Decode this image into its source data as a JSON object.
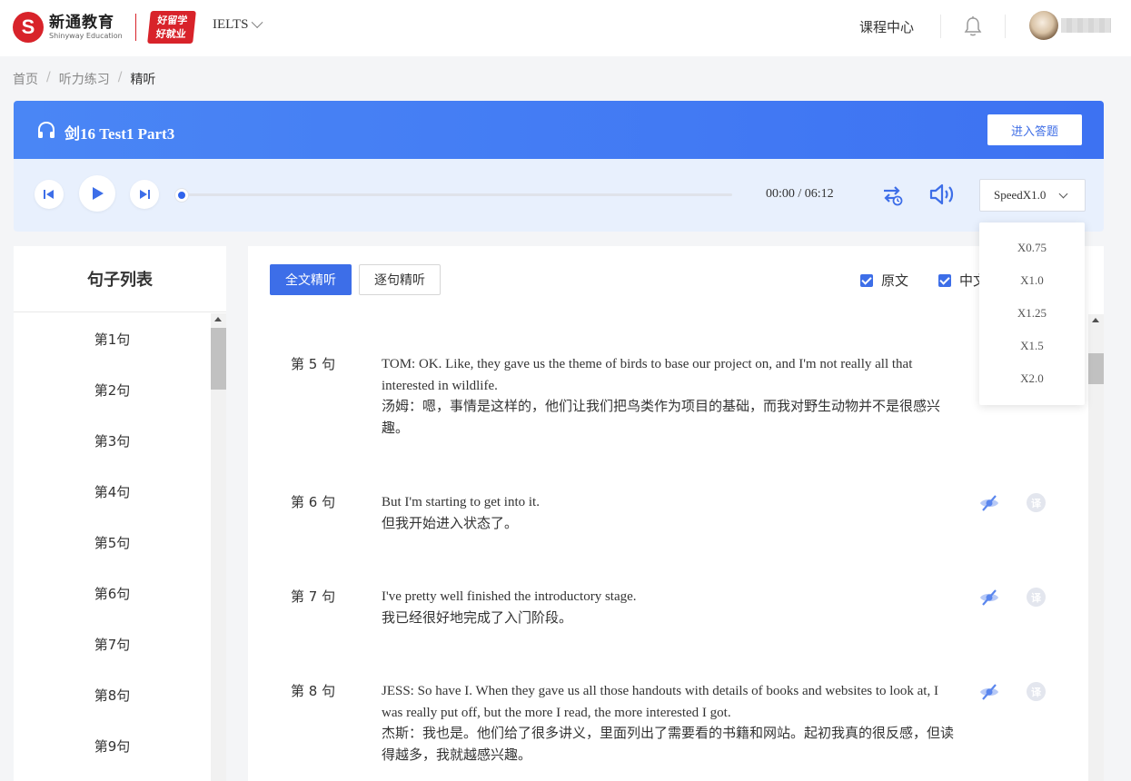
{
  "header": {
    "logo_cn": "新通教育",
    "logo_en": "Shinyway Education",
    "slogan_line1": "好留学",
    "slogan_line2": "好就业",
    "exam": "IELTS",
    "course_center": "课程中心"
  },
  "breadcrumb": {
    "home": "首页",
    "section": "听力练习",
    "current": "精听"
  },
  "player": {
    "title": "剑16 Test1 Part3",
    "answer_button": "进入答题",
    "time": "00:00 / 06:12",
    "progress": 0,
    "speed": "SpeedX1.0",
    "speed_options": [
      "X0.75",
      "X1.0",
      "X1.25",
      "X1.5",
      "X2.0"
    ]
  },
  "sidebar": {
    "title": "句子列表",
    "items": [
      "第1句",
      "第2句",
      "第3句",
      "第4句",
      "第5句",
      "第6句",
      "第7句",
      "第8句",
      "第9句"
    ]
  },
  "main": {
    "tabs": [
      "全文精听",
      "逐句精听"
    ],
    "toggles": [
      "原文",
      "中文"
    ],
    "sentences": [
      {
        "num": "第 5 句",
        "en": "TOM: OK. Like, they gave us the theme of birds to base our project on, and I'm not really all that interested in wildlife.",
        "cn": "汤姆：嗯，事情是这样的，他们让我们把鸟类作为项目的基础，而我对野生动物并不是很感兴趣。"
      },
      {
        "num": "第 6 句",
        "en": "But I'm starting to get into it.",
        "cn": "但我开始进入状态了。"
      },
      {
        "num": "第 7 句",
        "en": "I've pretty well finished the introductory stage.",
        "cn": "我已经很好地完成了入门阶段。"
      },
      {
        "num": "第 8 句",
        "en": "JESS: So have I. When they gave us all those handouts with details of books and websites to look at, I was really put off, but the more I read, the more interested I got.",
        "cn": "杰斯：我也是。他们给了很多讲义，里面列出了需要看的书籍和网站。起初我真的很反感，但读得越多，我就越感兴趣。"
      }
    ],
    "translate_icon": "译"
  },
  "colors": {
    "accent": "#3d6ee8",
    "banner": "#4a86f5",
    "brand_red": "#d8232a"
  }
}
